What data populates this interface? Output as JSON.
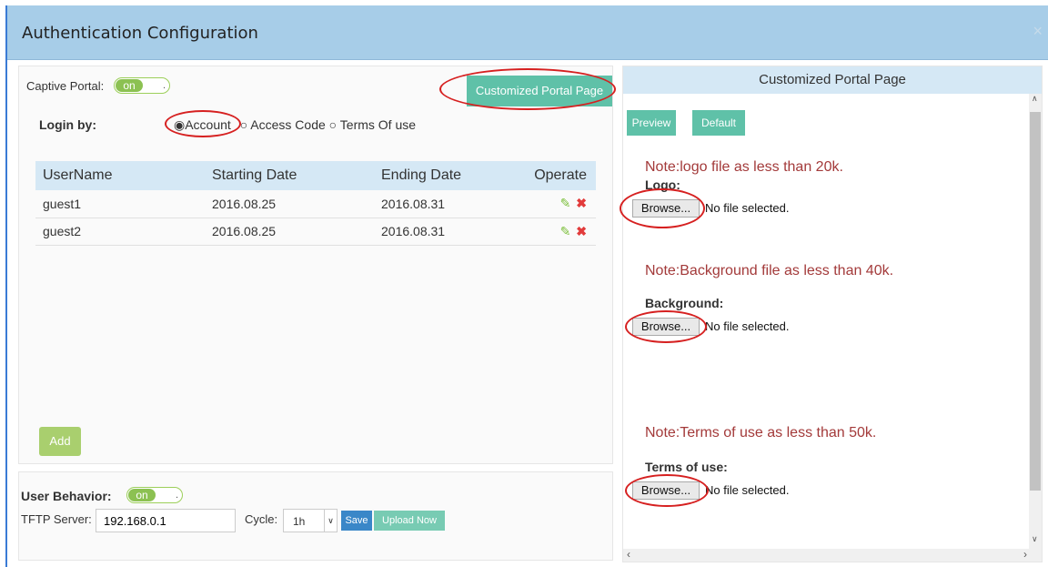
{
  "dialog": {
    "title": "Authentication Configuration",
    "close_glyph": "×"
  },
  "captive_portal": {
    "label": "Captive Portal:",
    "toggle_state": "on",
    "toggle_knob": "."
  },
  "customized_button_label": "Customized Portal Page",
  "login_by": {
    "label": "Login by:",
    "options": [
      "Account",
      "Access Code",
      "Terms Of use"
    ],
    "selected": "Account"
  },
  "users_table": {
    "columns": [
      "UserName",
      "Starting Date",
      "Ending Date",
      "Operate"
    ],
    "rows": [
      {
        "username": "guest1",
        "start": "2016.08.25",
        "end": "2016.08.31"
      },
      {
        "username": "guest2",
        "start": "2016.08.25",
        "end": "2016.08.31"
      }
    ]
  },
  "add_label": "Add",
  "user_behavior": {
    "label": "User Behavior:",
    "toggle_state": "on",
    "toggle_knob": ".",
    "tftp_label": "TFTP Server:",
    "tftp_value": "192.168.0.1",
    "cycle_label": "Cycle:",
    "cycle_value": "1h",
    "save_label": "Save",
    "upload_label": "Upload Now"
  },
  "right_panel": {
    "title": "Customized Portal Page",
    "preview_label": "Preview",
    "default_label": "Default",
    "logo_note": "Note:logo file as less than 20k.",
    "logo_label": "Logo:",
    "bg_note": "Note:Background file as less than 40k.",
    "bg_label": "Background:",
    "terms_note": "Note:Terms of use as less than 50k.",
    "terms_label": "Terms of use:",
    "browse_label": "Browse...",
    "no_file_label": "No file selected."
  },
  "colors": {
    "header": "#a7cde8",
    "teal_button": "#5fc1a8",
    "green_button": "#a9cf6e",
    "note_text": "#a33a3a",
    "annotation_red": "#d62020"
  }
}
